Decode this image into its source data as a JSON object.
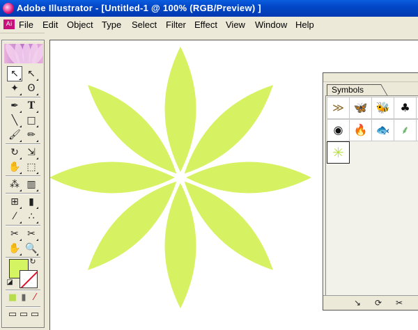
{
  "window": {
    "title": "Adobe Illustrator - [Untitled-1 @ 100% (RGB/Preview) ]"
  },
  "menu": [
    "File",
    "Edit",
    "Object",
    "Type",
    "Select",
    "Filter",
    "Effect",
    "View",
    "Window",
    "Help"
  ],
  "toolbox": {
    "icons": {
      "selection": "↖",
      "direct_selection": "↖",
      "magic_wand": "✦",
      "lasso": "ʘ",
      "pen": "✒",
      "type": "T",
      "line": "╲",
      "rectangle": "□",
      "paintbrush": "🖌",
      "pencil": "✏",
      "rotate": "↻",
      "scale": "⇲",
      "warp": "✋",
      "free_transform": "⬚",
      "symbol_sprayer": "⁂",
      "graph": "▥",
      "mesh": "⊞",
      "gradient": "▮",
      "eyedropper": "⁄",
      "blend": "∴",
      "slice": "✂",
      "scissors": "✂",
      "hand": "✋",
      "zoom": "🔍",
      "swap": "↻",
      "default": "◪",
      "color": "■",
      "gradient_mode": "▮",
      "none": "⁄",
      "screen_standard": "▭",
      "screen_menu": "▭",
      "screen_full": "▭"
    },
    "fill_color": "#d4f462"
  },
  "artwork": {
    "petal_color": "#d6f262",
    "petal_count": 8
  },
  "symbols_panel": {
    "tab_label": "Symbols",
    "symbols": [
      {
        "icon": "dragonfly",
        "glyph": "≫"
      },
      {
        "icon": "butterfly",
        "glyph": "🦋"
      },
      {
        "icon": "bee",
        "glyph": "🐝"
      },
      {
        "icon": "grapes",
        "glyph": "♣"
      },
      {
        "icon": "leaf",
        "glyph": "❦"
      },
      {
        "icon": "ring",
        "glyph": "◉"
      },
      {
        "icon": "fire",
        "glyph": "🔥"
      },
      {
        "icon": "fish",
        "glyph": "🐟"
      },
      {
        "icon": "grass",
        "glyph": "⸙"
      },
      {
        "icon": "flower",
        "glyph": "✺"
      },
      {
        "icon": "star-petal",
        "glyph": "✳"
      }
    ],
    "bottom_buttons": {
      "place": "↘",
      "replace": "⟳",
      "break_link": "✂"
    }
  }
}
